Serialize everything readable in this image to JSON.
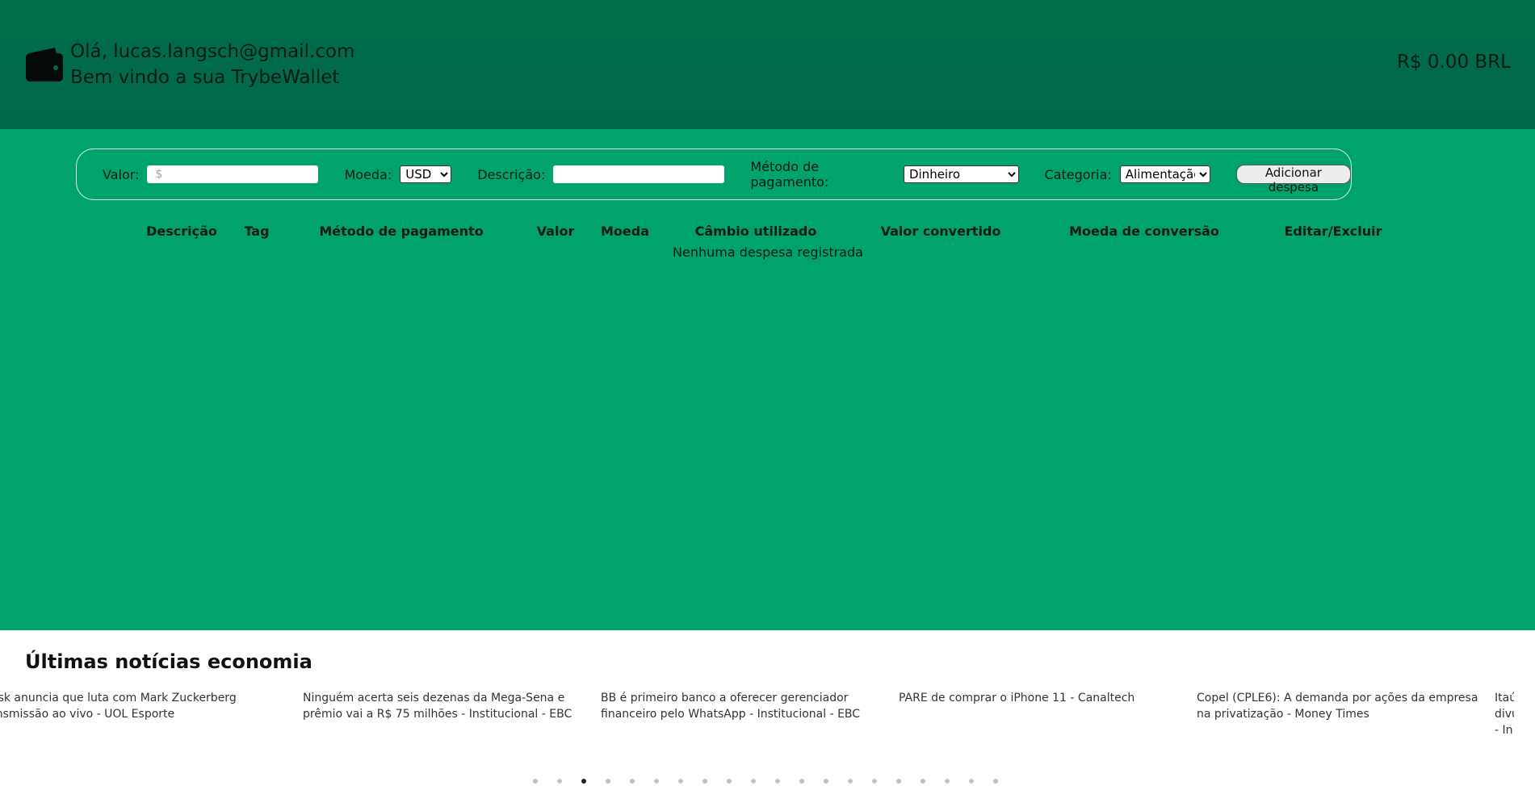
{
  "header": {
    "greeting": "Olá, lucas.langsch@gmail.com",
    "welcome": "Bem vindo a sua TrybeWallet",
    "total": "R$ 0.00 BRL",
    "icon": "wallet-icon"
  },
  "form": {
    "value_label": "Valor:",
    "value_placeholder": "$",
    "currency_label": "Moeda:",
    "currency_selected": "USD",
    "description_label": "Descrição:",
    "description_value": "",
    "method_label": "Método de pagamento:",
    "method_selected": "Dinheiro",
    "category_label": "Categoria:",
    "category_selected": "Alimentação",
    "add_button": "Adicionar despesa"
  },
  "table": {
    "headers": [
      "Descrição",
      "Tag",
      "Método de pagamento",
      "Valor",
      "Moeda",
      "Câmbio utilizado",
      "Valor convertido",
      "Moeda de conversão",
      "Editar/Excluir"
    ],
    "empty_message": "Nenhuma despesa registrada"
  },
  "news": {
    "title": "Últimas notícias economia",
    "items": [
      "Elon Musk anuncia que luta com Mark Zuckerberg terá transmissão ao vivo - UOL Esporte",
      "Ninguém acerta seis dezenas da Mega-Sena e prêmio vai a R$ 75 milhões - Institucional - EBC",
      "BB é primeiro banco a oferecer gerenciador financeiro pelo WhatsApp - Institucional - EBC",
      "PARE de comprar o iPhone 11 - Canaltech",
      "Copel (CPLE6): A demanda por ações da empresa na privatização - Money Times",
      "Itaú divulga - In"
    ],
    "active_dot": 3,
    "dot_count": 20
  },
  "colors": {
    "header": "#006b4a",
    "main": "#00a46a",
    "news_bg": "#ffffff"
  }
}
